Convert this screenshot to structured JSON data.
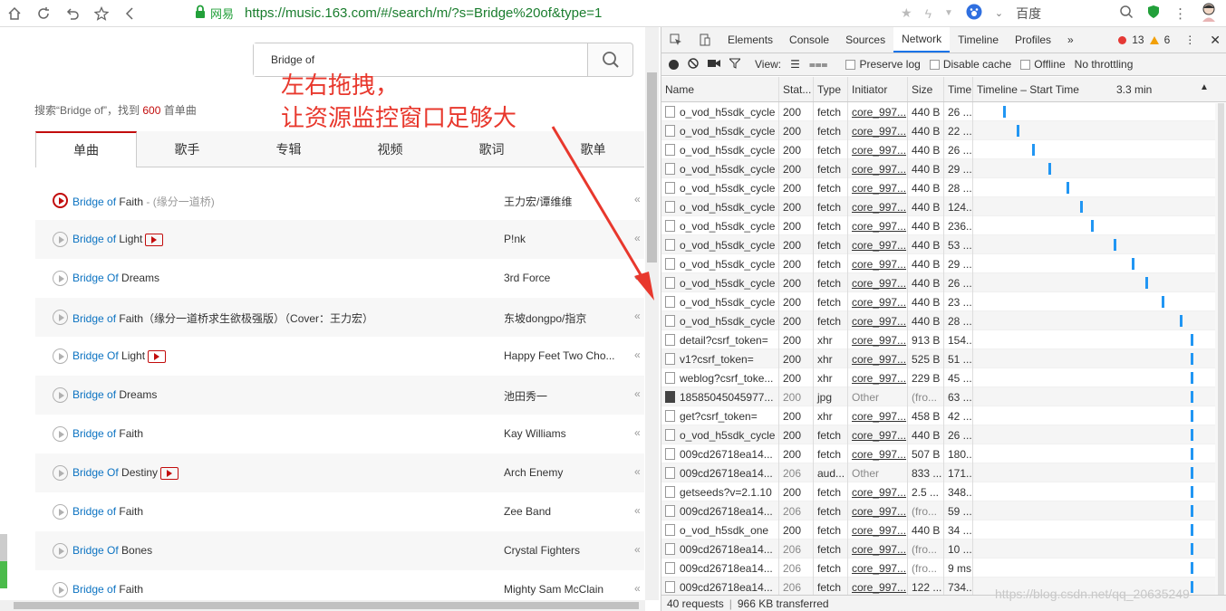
{
  "browser": {
    "site_name": "网易",
    "url": "https://music.163.com/#/search/m/?s=Bridge%20of&type=1",
    "search_engine": "百度"
  },
  "search": {
    "value": "Bridge of",
    "summary_prefix": "搜索“Bridge of”，找到 ",
    "count": "600",
    "summary_suffix": " 首单曲"
  },
  "tabs": [
    "单曲",
    "歌手",
    "专辑",
    "视频",
    "歌词",
    "歌单"
  ],
  "songs": [
    {
      "match": "Bridge of",
      "rest": " Faith",
      "sub": " - (缘分一道桥)",
      "artist": "王力宏/谭维维",
      "mv": false
    },
    {
      "match": "Bridge of",
      "rest": " Light",
      "sub": "",
      "artist": "P!nk",
      "mv": true
    },
    {
      "match": "Bridge Of",
      "rest": " Dreams",
      "sub": "",
      "artist": "3rd Force",
      "mv": false
    },
    {
      "match": "Bridge of",
      "rest": " Faith（缘分一道桥求生欲极强版）（Cover：王力宏）",
      "sub": "",
      "artist": "东坡dongpo/指京",
      "mv": false
    },
    {
      "match": "Bridge Of",
      "rest": " Light",
      "sub": "",
      "artist": "Happy Feet Two Cho...",
      "mv": true
    },
    {
      "match": "Bridge of",
      "rest": " Dreams",
      "sub": "",
      "artist": "池田秀一",
      "mv": false
    },
    {
      "match": "Bridge of",
      "rest": " Faith",
      "sub": "",
      "artist": "Kay Williams",
      "mv": false
    },
    {
      "match": "Bridge Of",
      "rest": " Destiny",
      "sub": "",
      "artist": "Arch Enemy",
      "mv": true
    },
    {
      "match": "Bridge of",
      "rest": " Faith",
      "sub": "",
      "artist": "Zee Band",
      "mv": false
    },
    {
      "match": "Bridge Of",
      "rest": " Bones",
      "sub": "",
      "artist": "Crystal Fighters",
      "mv": false
    },
    {
      "match": "Bridge of",
      "rest": " Faith",
      "sub": "",
      "artist": "Mighty Sam McClain",
      "mv": false
    }
  ],
  "annotation": {
    "line1": "左右拖拽，",
    "line2": "让资源监控窗口足够大"
  },
  "devtools": {
    "tabs": [
      "Elements",
      "Console",
      "Sources",
      "Network",
      "Timeline",
      "Profiles"
    ],
    "errors": "13",
    "warnings": "6",
    "toolbar": {
      "view_label": "View:",
      "preserve_log": "Preserve log",
      "disable_cache": "Disable cache",
      "offline": "Offline",
      "throttling": "No throttling"
    },
    "columns": {
      "name": "Name",
      "status": "Stat...",
      "type": "Type",
      "initiator": "Initiator",
      "size": "Size",
      "time": "Time",
      "timeline": "Timeline – Start Time",
      "timeline_mark": "3.3 min"
    },
    "rows": [
      {
        "name": "o_vod_h5sdk_cycle",
        "status": "200",
        "type": "fetch",
        "initiator": "core_997...",
        "size": "440 B",
        "time": "26 ...",
        "tl": 0.13,
        "kind": "doc"
      },
      {
        "name": "o_vod_h5sdk_cycle",
        "status": "200",
        "type": "fetch",
        "initiator": "core_997...",
        "size": "440 B",
        "time": "22 ...",
        "tl": 0.19,
        "kind": "doc"
      },
      {
        "name": "o_vod_h5sdk_cycle",
        "status": "200",
        "type": "fetch",
        "initiator": "core_997...",
        "size": "440 B",
        "time": "26 ...",
        "tl": 0.26,
        "kind": "doc"
      },
      {
        "name": "o_vod_h5sdk_cycle",
        "status": "200",
        "type": "fetch",
        "initiator": "core_997...",
        "size": "440 B",
        "time": "29 ...",
        "tl": 0.33,
        "kind": "doc"
      },
      {
        "name": "o_vod_h5sdk_cycle",
        "status": "200",
        "type": "fetch",
        "initiator": "core_997...",
        "size": "440 B",
        "time": "28 ...",
        "tl": 0.41,
        "kind": "doc"
      },
      {
        "name": "o_vod_h5sdk_cycle",
        "status": "200",
        "type": "fetch",
        "initiator": "core_997...",
        "size": "440 B",
        "time": "124...",
        "tl": 0.47,
        "kind": "doc"
      },
      {
        "name": "o_vod_h5sdk_cycle",
        "status": "200",
        "type": "fetch",
        "initiator": "core_997...",
        "size": "440 B",
        "time": "236...",
        "tl": 0.52,
        "kind": "doc"
      },
      {
        "name": "o_vod_h5sdk_cycle",
        "status": "200",
        "type": "fetch",
        "initiator": "core_997...",
        "size": "440 B",
        "time": "53 ...",
        "tl": 0.62,
        "kind": "doc"
      },
      {
        "name": "o_vod_h5sdk_cycle",
        "status": "200",
        "type": "fetch",
        "initiator": "core_997...",
        "size": "440 B",
        "time": "29 ...",
        "tl": 0.7,
        "kind": "doc"
      },
      {
        "name": "o_vod_h5sdk_cycle",
        "status": "200",
        "type": "fetch",
        "initiator": "core_997...",
        "size": "440 B",
        "time": "26 ...",
        "tl": 0.76,
        "kind": "doc"
      },
      {
        "name": "o_vod_h5sdk_cycle",
        "status": "200",
        "type": "fetch",
        "initiator": "core_997...",
        "size": "440 B",
        "time": "23 ...",
        "tl": 0.83,
        "kind": "doc"
      },
      {
        "name": "o_vod_h5sdk_cycle",
        "status": "200",
        "type": "fetch",
        "initiator": "core_997...",
        "size": "440 B",
        "time": "28 ...",
        "tl": 0.91,
        "kind": "doc"
      },
      {
        "name": "detail?csrf_token=",
        "status": "200",
        "type": "xhr",
        "initiator": "core_997...",
        "size": "913 B",
        "time": "154...",
        "tl": 0.96,
        "kind": "doc"
      },
      {
        "name": "v1?csrf_token=",
        "status": "200",
        "type": "xhr",
        "initiator": "core_997...",
        "size": "525 B",
        "time": "51 ...",
        "tl": 0.96,
        "kind": "doc"
      },
      {
        "name": "weblog?csrf_toke...",
        "status": "200",
        "type": "xhr",
        "initiator": "core_997...",
        "size": "229 B",
        "time": "45 ...",
        "tl": 0.96,
        "kind": "doc"
      },
      {
        "name": "18585045045977...",
        "status": "200",
        "type": "jpg",
        "initiator": "Other",
        "size": "(fro...",
        "time": "63 ...",
        "tl": 0.96,
        "kind": "img",
        "gray": true
      },
      {
        "name": "get?csrf_token=",
        "status": "200",
        "type": "xhr",
        "initiator": "core_997...",
        "size": "458 B",
        "time": "42 ...",
        "tl": 0.96,
        "kind": "doc"
      },
      {
        "name": "o_vod_h5sdk_cycle",
        "status": "200",
        "type": "fetch",
        "initiator": "core_997...",
        "size": "440 B",
        "time": "26 ...",
        "tl": 0.96,
        "kind": "doc"
      },
      {
        "name": "009cd26718ea14...",
        "status": "200",
        "type": "fetch",
        "initiator": "core_997...",
        "size": "507 B",
        "time": "180...",
        "tl": 0.96,
        "kind": "doc"
      },
      {
        "name": "009cd26718ea14...",
        "status": "206",
        "type": "aud...",
        "initiator": "Other",
        "size": "833 ...",
        "time": "171...",
        "tl": 0.96,
        "kind": "doc",
        "gray": true
      },
      {
        "name": "getseeds?v=2.1.10",
        "status": "200",
        "type": "fetch",
        "initiator": "core_997...",
        "size": "2.5 ...",
        "time": "348...",
        "tl": 0.96,
        "kind": "doc"
      },
      {
        "name": "009cd26718ea14...",
        "status": "206",
        "type": "fetch",
        "initiator": "core_997...",
        "size": "(fro...",
        "time": "59 ...",
        "tl": 0.96,
        "kind": "doc",
        "gray": true
      },
      {
        "name": "o_vod_h5sdk_one",
        "status": "200",
        "type": "fetch",
        "initiator": "core_997...",
        "size": "440 B",
        "time": "34 ...",
        "tl": 0.96,
        "kind": "doc"
      },
      {
        "name": "009cd26718ea14...",
        "status": "206",
        "type": "fetch",
        "initiator": "core_997...",
        "size": "(fro...",
        "time": "10 ...",
        "tl": 0.96,
        "kind": "doc",
        "gray": true
      },
      {
        "name": "009cd26718ea14...",
        "status": "206",
        "type": "fetch",
        "initiator": "core_997...",
        "size": "(fro...",
        "time": "9 ms",
        "tl": 0.96,
        "kind": "doc",
        "gray": true
      },
      {
        "name": "009cd26718ea14...",
        "status": "206",
        "type": "fetch",
        "initiator": "core_997...",
        "size": "122 ...",
        "time": "734...",
        "tl": 0.96,
        "kind": "doc",
        "gray": true
      }
    ],
    "footer": {
      "requests": "40 requests",
      "transferred": "966 KB transferred"
    }
  },
  "watermark": "https://blog.csdn.net/qq_20635249",
  "colors": {
    "accent_red": "#c20c0c",
    "link_blue": "#0c73c2",
    "annotation_red": "#e8382d",
    "timeline_bar": "#2196f3"
  }
}
